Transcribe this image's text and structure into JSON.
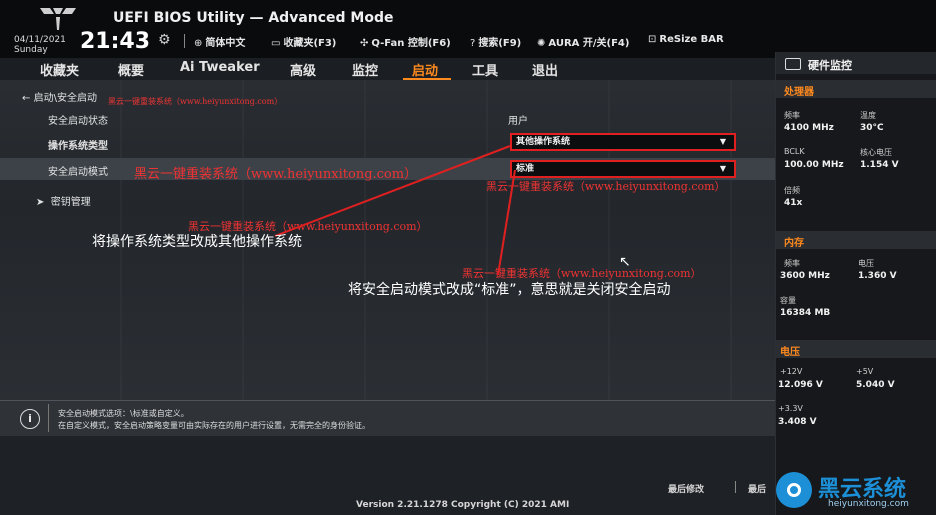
{
  "header": {
    "title": "UEFI BIOS Utility — Advanced Mode",
    "date": "04/11/2021",
    "weekday": "Sunday",
    "time": "21:43",
    "tools": [
      {
        "icon": "globe-icon",
        "label": "简体中文"
      },
      {
        "icon": "bookmark-icon",
        "label": "收藏夹(F3)"
      },
      {
        "icon": "fan-icon",
        "label": "Q-Fan 控制(F6)"
      },
      {
        "icon": "help-icon",
        "label": "搜索(F9)"
      },
      {
        "icon": "aura-icon",
        "label": "AURA 开/关(F4)"
      },
      {
        "icon": "resize-icon",
        "label": "ReSize BAR"
      }
    ]
  },
  "menu": {
    "items": [
      "收藏夹",
      "概要",
      "Ai Tweaker",
      "高级",
      "监控",
      "启动",
      "工具",
      "退出"
    ],
    "active": "启动"
  },
  "main": {
    "breadcrumb": "启动\\安全启动",
    "secure_boot_state_label": "安全启动状态",
    "secure_boot_state_value": "用户",
    "os_type_label": "操作系统类型",
    "os_type_value": "其他操作系统",
    "secure_boot_mode_label": "安全启动模式",
    "secure_boot_mode_value": "标准",
    "key_management_label": "密钥管理"
  },
  "watermarks": {
    "w1": "黑云一键重装系统（www.heiyunxitong.com）",
    "w2": "黑云一键重装系统（www.heiyunxitong.com）",
    "w3": "黑云一键重装系统（www.heiyunxitong.com）",
    "w4": "黑云一键重装系统（www.heiyunxitong.com）",
    "w5": "黑云一键重装系统（www.heiyunxitong.com）"
  },
  "annotations": {
    "a1": "将操作系统类型改成其他操作系统",
    "a2": "将安全启动模式改成“标准”，意思就是关闭安全启动"
  },
  "info": {
    "line1": "安全启动模式选项：\\标准或自定义。",
    "line2": "在自定义模式，安全启动策略变量可由实际存在的用户进行设置，无需完全的身份验证。"
  },
  "footer": {
    "version": "Version 2.21.1278 Copyright (C) 2021 AMI",
    "last_modified": "最后修改",
    "last_partial": "最后"
  },
  "hw_monitor": {
    "title": "硬件监控",
    "cpu": {
      "section": "处理器",
      "freq_label": "频率",
      "freq_value": "4100 MHz",
      "temp_label": "温度",
      "temp_value": "30°C",
      "bclk_label": "BCLK",
      "bclk_value": "100.00 MHz",
      "vcore_label": "核心电压",
      "vcore_value": "1.154 V",
      "ratio_label": "倍频",
      "ratio_value": "41x"
    },
    "memory": {
      "section": "内存",
      "freq_label": "频率",
      "freq_value": "3600 MHz",
      "volt_label": "电压",
      "volt_value": "1.360 V",
      "cap_label": "容量",
      "cap_value": "16384 MB"
    },
    "voltage": {
      "section": "电压",
      "v12_label": "+12V",
      "v12_value": "12.096 V",
      "v5_label": "+5V",
      "v5_value": "5.040 V",
      "v33_label": "+3.3V",
      "v33_value": "3.408 V"
    }
  },
  "brand": {
    "name": "黑云系统",
    "url": "heiyunxitong.com"
  },
  "colors": {
    "accent": "#ff8a1e",
    "highlight_border": "#e02020",
    "brand_blue": "#1c8fd6"
  }
}
